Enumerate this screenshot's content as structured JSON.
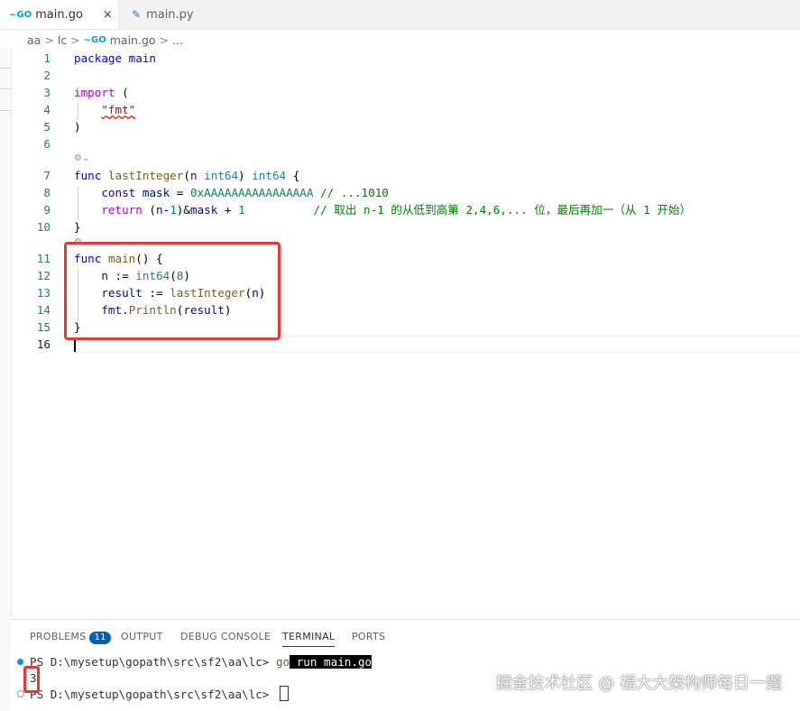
{
  "tabs": [
    {
      "icon": "go-file-icon",
      "icon_glyph": "~GO",
      "label": "main.go",
      "close": "×",
      "active": true
    },
    {
      "icon": "python-file-icon",
      "icon_glyph": "✎",
      "label": "main.py",
      "active": false
    }
  ],
  "breadcrumb": {
    "parts": [
      "aa",
      "lc",
      "main.go",
      "..."
    ],
    "separator": ">",
    "go_glyph": "~GO"
  },
  "code": {
    "lines": [
      {
        "n": "1",
        "tokens": [
          [
            "kw",
            "package"
          ],
          [
            "pl",
            " "
          ],
          [
            "id",
            "main"
          ]
        ]
      },
      {
        "n": "2",
        "tokens": []
      },
      {
        "n": "3",
        "tokens": [
          [
            "ctrl",
            "import"
          ],
          [
            "pl",
            " ("
          ]
        ]
      },
      {
        "n": "4",
        "tokens": [
          [
            "pl",
            "    "
          ],
          [
            "str",
            "\"fmt\""
          ]
        ]
      },
      {
        "n": "5",
        "tokens": [
          [
            "pl",
            ")"
          ]
        ]
      },
      {
        "n": "6",
        "tokens": []
      },
      {
        "n": "7",
        "tokens": [
          [
            "kw",
            "func"
          ],
          [
            "pl",
            " "
          ],
          [
            "fn",
            "lastInteger"
          ],
          [
            "pl",
            "("
          ],
          [
            "id",
            "n"
          ],
          [
            "pl",
            " "
          ],
          [
            "ty",
            "int64"
          ],
          [
            "pl",
            ") "
          ],
          [
            "ty",
            "int64"
          ],
          [
            "pl",
            " {"
          ]
        ]
      },
      {
        "n": "8",
        "tokens": [
          [
            "pl",
            "    "
          ],
          [
            "kw",
            "const"
          ],
          [
            "pl",
            " "
          ],
          [
            "id",
            "mask"
          ],
          [
            "pl",
            " = "
          ],
          [
            "num",
            "0xAAAAAAAAAAAAAAAA"
          ],
          [
            "pl",
            " "
          ],
          [
            "cm",
            "// ...1010"
          ]
        ]
      },
      {
        "n": "9",
        "tokens": [
          [
            "pl",
            "    "
          ],
          [
            "ctrl",
            "return"
          ],
          [
            "pl",
            " ("
          ],
          [
            "id",
            "n"
          ],
          [
            "pl",
            "-"
          ],
          [
            "num",
            "1"
          ],
          [
            "pl",
            ")&"
          ],
          [
            "id",
            "mask"
          ],
          [
            "pl",
            " + "
          ],
          [
            "num",
            "1"
          ],
          [
            "pl",
            "          "
          ],
          [
            "cm",
            "// 取出 n-1 的从低到高第 2,4,6,... 位，最后再加一（从 1 开始）"
          ]
        ]
      },
      {
        "n": "10",
        "tokens": [
          [
            "pl",
            "}"
          ]
        ]
      },
      {
        "n": "11",
        "tokens": [
          [
            "kw",
            "func"
          ],
          [
            "pl",
            " "
          ],
          [
            "fn",
            "main"
          ],
          [
            "pl",
            "() {"
          ]
        ]
      },
      {
        "n": "12",
        "tokens": [
          [
            "pl",
            "    "
          ],
          [
            "id",
            "n"
          ],
          [
            "pl",
            " := "
          ],
          [
            "ty",
            "int64"
          ],
          [
            "pl",
            "("
          ],
          [
            "num",
            "8"
          ],
          [
            "pl",
            ")"
          ]
        ]
      },
      {
        "n": "13",
        "tokens": [
          [
            "pl",
            "    "
          ],
          [
            "id",
            "result"
          ],
          [
            "pl",
            " := "
          ],
          [
            "fn",
            "lastInteger"
          ],
          [
            "pl",
            "("
          ],
          [
            "id",
            "n"
          ],
          [
            "pl",
            ")"
          ]
        ]
      },
      {
        "n": "14",
        "tokens": [
          [
            "pl",
            "    "
          ],
          [
            "id",
            "fmt"
          ],
          [
            "pl",
            "."
          ],
          [
            "fn",
            "Println"
          ],
          [
            "pl",
            "("
          ],
          [
            "id",
            "result"
          ],
          [
            "pl",
            ")"
          ]
        ]
      },
      {
        "n": "15",
        "tokens": [
          [
            "pl",
            "}"
          ]
        ]
      },
      {
        "n": "16",
        "tokens": []
      }
    ],
    "codelens_glyph": "⚙⌄"
  },
  "panel": {
    "tabs": [
      "PROBLEMS",
      "OUTPUT",
      "DEBUG CONSOLE",
      "TERMINAL",
      "PORTS"
    ],
    "problems_count": "11",
    "active_tab": "TERMINAL"
  },
  "terminal": {
    "prompt1": "PS D:\\mysetup\\gopath\\src\\sf2\\aa\\lc> ",
    "cmd_go": "go",
    "cmd_rest": " run main.go",
    "output": "3",
    "prompt2": "PS D:\\mysetup\\gopath\\src\\sf2\\aa\\lc> "
  },
  "watermark": "掘金技术社区 @ 福大大架构师每日一题",
  "colors": {
    "accent": "#005fb8",
    "highlight_red": "#e53935",
    "keyword": "#0000ff",
    "function": "#795e26",
    "comment": "#008000",
    "number": "#098658"
  }
}
